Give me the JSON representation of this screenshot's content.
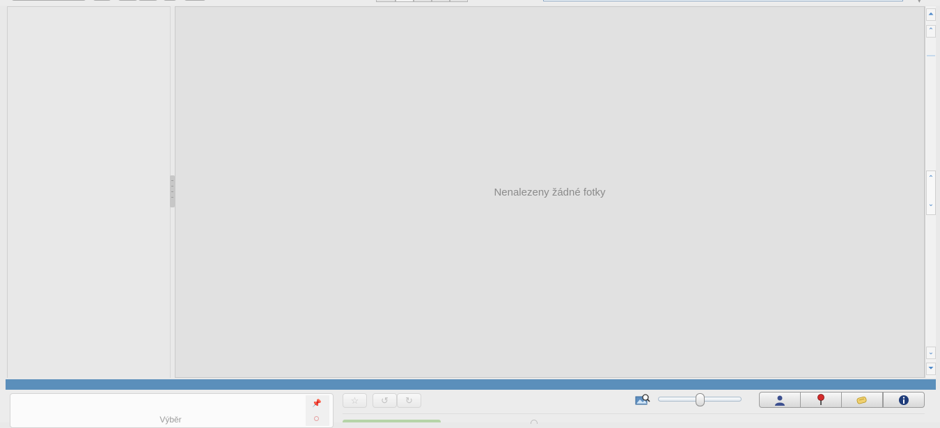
{
  "main": {
    "empty_message": "Nenalezeny žádné fotky"
  },
  "selection_panel": {
    "label": "Výběr"
  },
  "toolbar": {
    "favorite_icon": "star-icon",
    "rotate_left_icon": "rotate-left-icon",
    "rotate_right_icon": "rotate-right-icon"
  },
  "zoom": {
    "icon": "zoom-picture-icon",
    "level": 0.5
  },
  "info_tabs": [
    {
      "name": "people",
      "icon": "person-icon"
    },
    {
      "name": "places",
      "icon": "map-pin-icon"
    },
    {
      "name": "tags",
      "icon": "tag-icon"
    },
    {
      "name": "info",
      "icon": "info-icon"
    }
  ],
  "colors": {
    "accent_blue": "#5b8fbb",
    "scroll_arrow": "#4d88c9",
    "pin_red": "#d42b2b",
    "info_navy": "#1f3c7a"
  }
}
